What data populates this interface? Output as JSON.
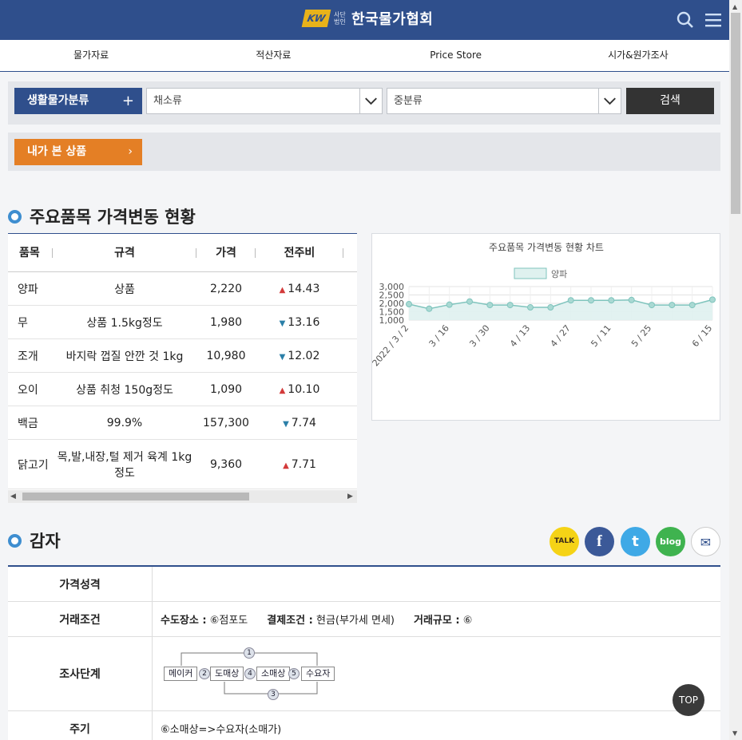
{
  "header": {
    "logo_mark": "KW",
    "logo_sub": "사단 법인",
    "logo_name": "한국물가협회"
  },
  "nav": [
    "물가자료",
    "적산자료",
    "Price Store",
    "시가&원가조사"
  ],
  "search": {
    "category_label": "생활물가분류",
    "category_plus": "+",
    "major_value": "채소류",
    "minor_value": "중분류",
    "search_label": "검색"
  },
  "viewed": {
    "label": "내가 본 상품",
    "chevron": "›"
  },
  "price_section": {
    "title": "주요품목 가격변동 현황",
    "columns": [
      "품목",
      "규격",
      "가격",
      "전주비"
    ],
    "rows": [
      {
        "item": "양파",
        "spec": "상품",
        "price": "2,220",
        "dir": "up",
        "change": "14.43"
      },
      {
        "item": "무",
        "spec": "상품 1.5kg정도",
        "price": "1,980",
        "dir": "down",
        "change": "13.16"
      },
      {
        "item": "조개",
        "spec": "바지락 껍질 안깐 것 1kg",
        "price": "10,980",
        "dir": "down",
        "change": "12.02"
      },
      {
        "item": "오이",
        "spec": "상품 취청 150g정도",
        "price": "1,090",
        "dir": "up",
        "change": "10.10"
      },
      {
        "item": "백금",
        "spec": "99.9%",
        "price": "157,300",
        "dir": "down",
        "change": "7.74"
      },
      {
        "item": "닭고기",
        "spec": "목,발,내장,털 제거 육계 1kg정도",
        "price": "9,360",
        "dir": "up",
        "change": "7.71"
      }
    ]
  },
  "chart_data": {
    "type": "area",
    "title": "주요품목 가격변동 현황 차트",
    "series": [
      {
        "name": "양파",
        "values": [
          1950,
          1680,
          1920,
          2110,
          1900,
          1900,
          1760,
          1760,
          2180,
          2180,
          2180,
          2200,
          1900,
          1900,
          1900,
          2220
        ]
      }
    ],
    "x": [
      "2022 / 3 / 2",
      "",
      "3 / 16",
      "",
      "3 / 30",
      "",
      "4 / 13",
      "",
      "4 / 27",
      "",
      "5 / 11",
      "",
      "5 / 25",
      "",
      "",
      "6 / 15"
    ],
    "y_ticks": [
      "3,000",
      "2,500",
      "2,000",
      "1,500",
      "1,000"
    ],
    "ylim": [
      1000,
      3000
    ],
    "grid": true,
    "legend": "top",
    "colors": {
      "line": "#7fc4bd",
      "fill": "#dff1ef",
      "point": "#a9d9d3"
    }
  },
  "product": {
    "title": "감자",
    "share_icons": [
      "kakao-talk-icon",
      "facebook-icon",
      "twitter-icon",
      "blog-icon",
      "email-icon"
    ],
    "share_labels": {
      "kakao": "TALK",
      "facebook": "f",
      "twitter": "t",
      "blog": "blog",
      "email": "✉"
    },
    "rows": {
      "price_nature_label": "가격성격",
      "price_nature_value": "",
      "trade_label": "거래조건",
      "delivery_key": "수도장소 :",
      "delivery_val": "⑥점포도",
      "payment_key": "결제조건 :",
      "payment_val": "현금(부가세 면세)",
      "scale_key": "거래규모 :",
      "scale_val": "⑥",
      "stage_label": "조사단계",
      "stages": [
        "메이커",
        "도매상",
        "소매상",
        "수요자"
      ],
      "stage_nums": [
        "1",
        "2",
        "3",
        "4",
        "5"
      ],
      "cycle_label": "주기",
      "cycle_value": "⑥소매상=>수요자(소매가)"
    }
  },
  "top_button": "TOP"
}
